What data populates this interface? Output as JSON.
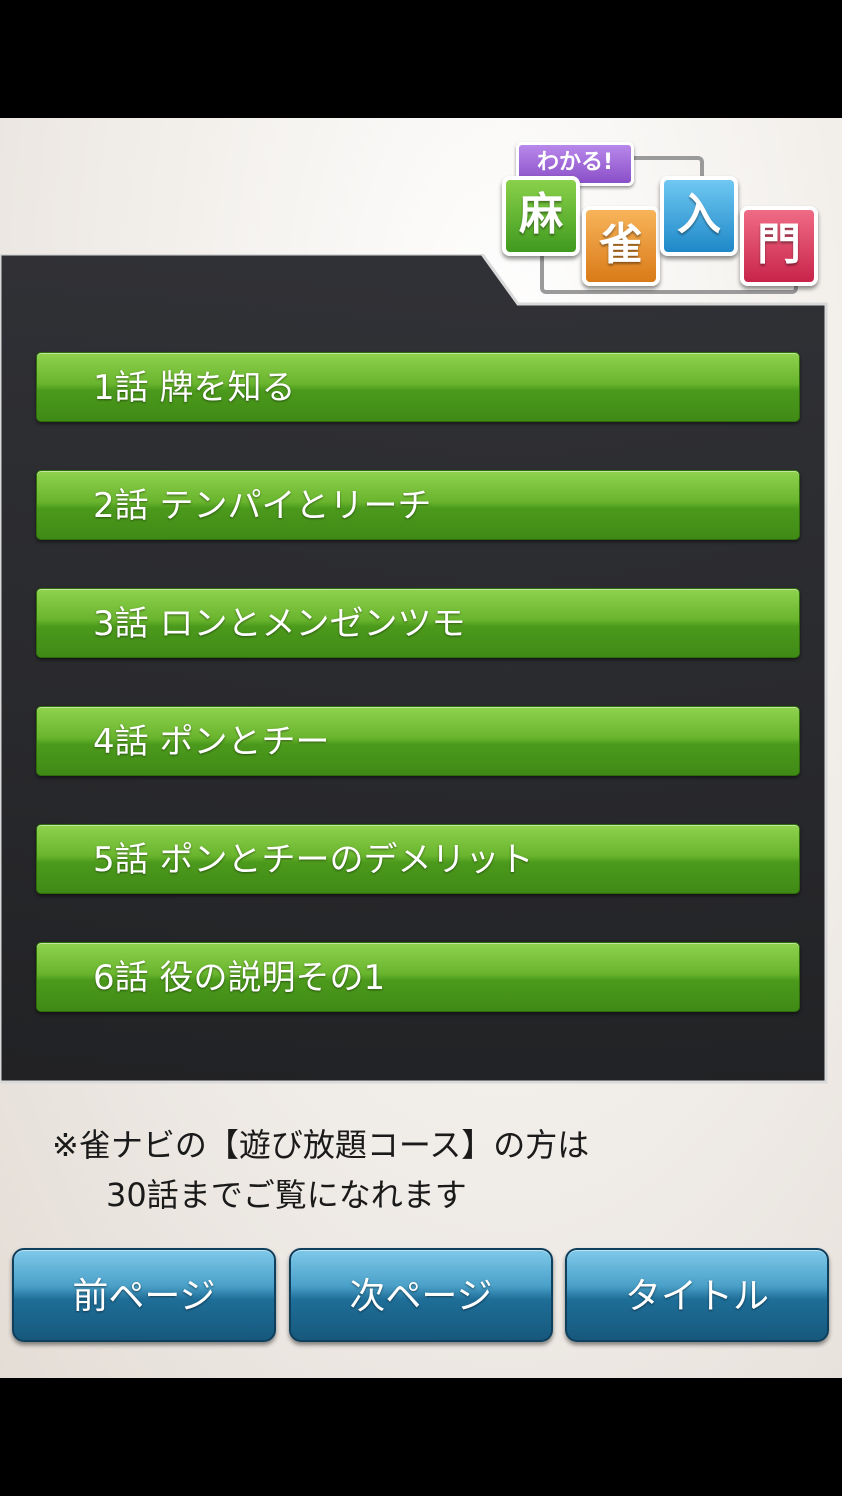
{
  "logo": {
    "tag": "わかる!",
    "tiles": [
      "麻",
      "雀",
      "入",
      "門"
    ]
  },
  "episodes": [
    {
      "label": "1話 牌を知る"
    },
    {
      "label": "2話 テンパイとリーチ"
    },
    {
      "label": "3話 ロンとメンゼンツモ"
    },
    {
      "label": "4話 ポンとチー"
    },
    {
      "label": "5話 ポンとチーのデメリット"
    },
    {
      "label": "6話 役の説明その1"
    }
  ],
  "notice": {
    "line1": "※雀ナビの【遊び放題コース】の方は",
    "line2": "30話までご覧になれます"
  },
  "nav": {
    "prev": "前ページ",
    "next": "次ページ",
    "title": "タイトル"
  },
  "colors": {
    "episode_green": "#6ab52e",
    "nav_blue": "#1e6e98",
    "panel_dark": "#1c1d21"
  }
}
